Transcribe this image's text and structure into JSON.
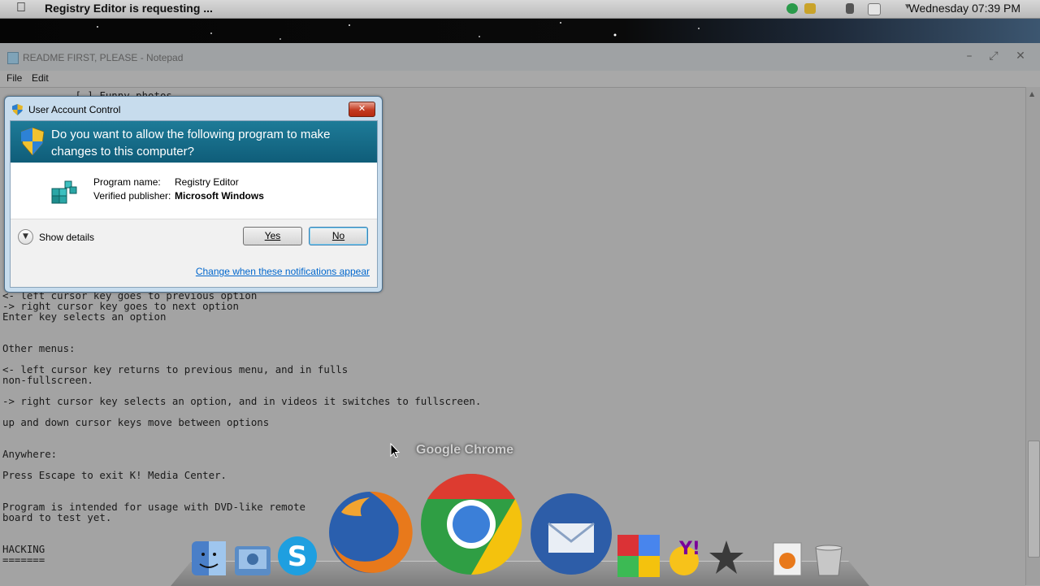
{
  "menubar": {
    "app_title": "Registry Editor is requesting ...",
    "clock": "Wednesday 07:39 PM"
  },
  "notepad": {
    "title": "README FIRST, PLEASE - Notepad",
    "menu": [
      "File",
      "Edit"
    ],
    "window_controls": [
      "minimize",
      "maximize",
      "close"
    ],
    "lines": [
      {
        "text": "            [.] Funny photos"
      },
      {
        "text": "<- left cursor key goes to previous option"
      },
      {
        "text": "-> right cursor key goes to next option"
      },
      {
        "text": "Enter key selects an option"
      },
      {
        "text": "Other menus:"
      },
      {
        "text": "<- left cursor key returns to previous menu, and in fulls"
      },
      {
        "text": "non-fullscreen."
      },
      {
        "text": "-> right cursor key selects an option, and in videos it switches to fullscreen."
      },
      {
        "text": "up and down cursor keys move between options"
      },
      {
        "text": "Anywhere:"
      },
      {
        "text": "Press Escape to exit K! Media Center."
      },
      {
        "text": "Program is intended for usage with DVD-like remote"
      },
      {
        "text": "board to test yet."
      },
      {
        "text": "HACKING"
      },
      {
        "text": "======="
      }
    ]
  },
  "uac": {
    "title": "User Account Control",
    "question": "Do you want to allow the following program to make changes to this computer?",
    "program_name_label": "Program name:",
    "program_name": "Registry Editor",
    "publisher_label": "Verified publisher:",
    "publisher": "Microsoft Windows",
    "show_details": "Show details",
    "yes": "Yes",
    "no": "No",
    "link": "Change when these notifications appear"
  },
  "dock": {
    "hover_label": "Google Chrome",
    "icons": [
      "finder-icon",
      "iphoto-icon",
      "skype-icon",
      "firefox-icon",
      "chrome-icon",
      "thunderbird-icon",
      "google-icon",
      "yahoo-messenger-icon",
      "imovie-icon",
      "document-icon",
      "trash-icon"
    ]
  }
}
